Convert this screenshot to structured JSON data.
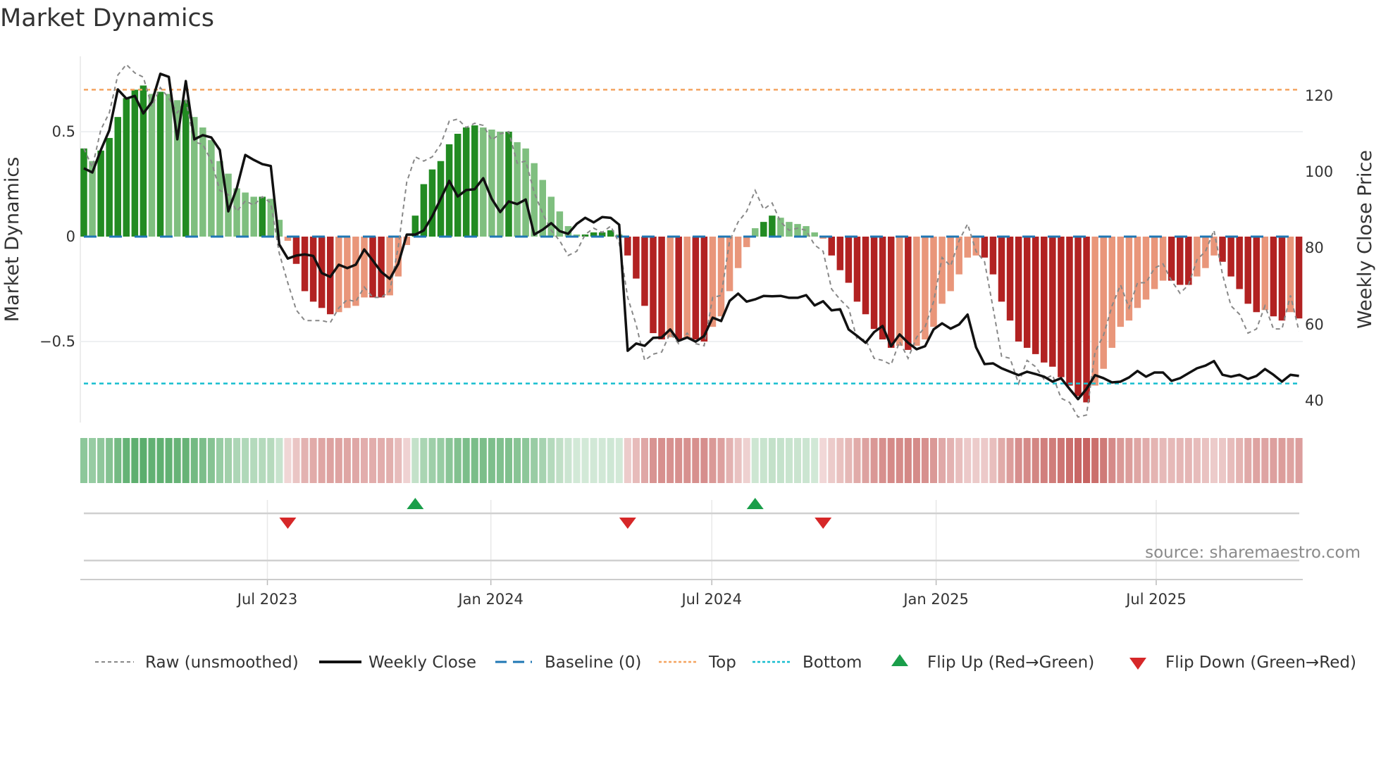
{
  "title": "Market Dynamics",
  "source": "source: sharemaestro.com",
  "chart_data": {
    "type": "bar",
    "title": "Market Dynamics",
    "ylabel": "Market Dynamics",
    "y2label": "Weekly Close Price",
    "ylim": [
      -0.88,
      0.86
    ],
    "y2lim": [
      35,
      130
    ],
    "yticks": [
      {
        "v": 0.5,
        "label": "0.5"
      },
      {
        "v": 0,
        "label": "0"
      },
      {
        "v": -0.5,
        "label": "−0.5"
      }
    ],
    "y2ticks": [
      {
        "v": 120,
        "label": "120"
      },
      {
        "v": 100,
        "label": "100"
      },
      {
        "v": 80,
        "label": "80"
      },
      {
        "v": 60,
        "label": "60"
      },
      {
        "v": 40,
        "label": "40"
      }
    ],
    "xticks": [
      {
        "week": 21.6,
        "label": "Jul 2023"
      },
      {
        "week": 47.9,
        "label": "Jan 2024"
      },
      {
        "week": 73.9,
        "label": "Jul 2024"
      },
      {
        "week": 100.3,
        "label": "Jan 2025"
      },
      {
        "week": 126.2,
        "label": "Jul 2025"
      }
    ],
    "top": 0.7,
    "bottom": -0.7,
    "baseline": 0,
    "colors": {
      "pos_strong": "#228b22",
      "pos_weak": "#7fbf7f",
      "neg_strong": "#b22222",
      "neg_weak": "#e9967a",
      "close": "#111111",
      "raw": "#888888",
      "baseline": "#1f77b4",
      "top": "#f4a460",
      "bottom": "#17becf",
      "flip_up": "#1a9e4a",
      "flip_down": "#d62728",
      "heat_pos": "#3a9d4f",
      "heat_neg": "#c0504d"
    },
    "values": [
      0.42,
      0.36,
      0.41,
      0.47,
      0.57,
      0.66,
      0.7,
      0.72,
      0.68,
      0.69,
      0.68,
      0.65,
      0.65,
      0.57,
      0.52,
      0.46,
      0.36,
      0.3,
      0.23,
      0.21,
      0.19,
      0.19,
      0.18,
      0.08,
      -0.02,
      -0.13,
      -0.26,
      -0.31,
      -0.34,
      -0.37,
      -0.36,
      -0.34,
      -0.33,
      -0.29,
      -0.29,
      -0.29,
      -0.28,
      -0.19,
      -0.04,
      0.1,
      0.25,
      0.32,
      0.36,
      0.44,
      0.49,
      0.52,
      0.53,
      0.52,
      0.51,
      0.5,
      0.5,
      0.45,
      0.42,
      0.35,
      0.27,
      0.19,
      0.12,
      0.05,
      0.01,
      0.01,
      0.02,
      0.02,
      0.03,
      0.01,
      -0.09,
      -0.2,
      -0.33,
      -0.46,
      -0.49,
      -0.48,
      -0.49,
      -0.48,
      -0.49,
      -0.5,
      -0.43,
      -0.38,
      -0.26,
      -0.15,
      -0.05,
      0.04,
      0.07,
      0.1,
      0.09,
      0.07,
      0.06,
      0.05,
      0.02,
      -0.01,
      -0.09,
      -0.16,
      -0.22,
      -0.31,
      -0.37,
      -0.44,
      -0.49,
      -0.53,
      -0.52,
      -0.54,
      -0.52,
      -0.49,
      -0.43,
      -0.32,
      -0.26,
      -0.18,
      -0.1,
      -0.09,
      -0.1,
      -0.18,
      -0.31,
      -0.4,
      -0.5,
      -0.53,
      -0.56,
      -0.6,
      -0.62,
      -0.67,
      -0.71,
      -0.76,
      -0.79,
      -0.71,
      -0.63,
      -0.53,
      -0.43,
      -0.4,
      -0.34,
      -0.3,
      -0.25,
      -0.21,
      -0.21,
      -0.23,
      -0.23,
      -0.19,
      -0.15,
      -0.09,
      -0.12,
      -0.19,
      -0.25,
      -0.32,
      -0.36,
      -0.35,
      -0.38,
      -0.4,
      -0.36,
      -0.39
    ],
    "raw": [
      0.42,
      0.33,
      0.51,
      0.59,
      0.77,
      0.82,
      0.78,
      0.76,
      0.62,
      0.71,
      0.66,
      0.59,
      0.65,
      0.45,
      0.44,
      0.36,
      0.22,
      0.2,
      0.12,
      0.17,
      0.15,
      0.19,
      0.16,
      -0.08,
      -0.22,
      -0.35,
      -0.4,
      -0.4,
      -0.4,
      -0.41,
      -0.34,
      -0.3,
      -0.31,
      -0.24,
      -0.29,
      -0.29,
      -0.26,
      -0.05,
      0.26,
      0.38,
      0.36,
      0.38,
      0.44,
      0.55,
      0.56,
      0.52,
      0.54,
      0.53,
      0.46,
      0.49,
      0.5,
      0.35,
      0.36,
      0.21,
      0.11,
      0.03,
      -0.02,
      -0.09,
      -0.07,
      0.01,
      0.04,
      0.02,
      0.05,
      -0.03,
      -0.29,
      -0.42,
      -0.59,
      -0.56,
      -0.55,
      -0.46,
      -0.51,
      -0.46,
      -0.51,
      -0.52,
      -0.29,
      -0.28,
      -0.02,
      0.07,
      0.12,
      0.22,
      0.13,
      0.16,
      0.07,
      0.03,
      0.04,
      0.03,
      -0.04,
      -0.07,
      -0.25,
      -0.3,
      -0.34,
      -0.49,
      -0.49,
      -0.58,
      -0.59,
      -0.61,
      -0.5,
      -0.58,
      -0.48,
      -0.43,
      -0.31,
      -0.1,
      -0.14,
      -0.02,
      0.06,
      -0.07,
      -0.12,
      -0.34,
      -0.57,
      -0.58,
      -0.7,
      -0.59,
      -0.62,
      -0.68,
      -0.66,
      -0.77,
      -0.79,
      -0.86,
      -0.85,
      -0.55,
      -0.47,
      -0.33,
      -0.23,
      -0.34,
      -0.22,
      -0.22,
      -0.15,
      -0.13,
      -0.21,
      -0.27,
      -0.23,
      -0.11,
      -0.07,
      0.03,
      -0.18,
      -0.33,
      -0.37,
      -0.46,
      -0.44,
      -0.33,
      -0.44,
      -0.44,
      -0.28,
      -0.45
    ],
    "close": [
      101,
      99.9,
      105.8,
      111,
      121.7,
      119.3,
      120,
      115.4,
      118.4,
      125.8,
      125,
      108.6,
      123.9,
      108.6,
      109.7,
      109.1,
      105.8,
      89.7,
      95.8,
      104.5,
      103.2,
      102.1,
      101.6,
      81,
      77.3,
      78.1,
      78.4,
      78,
      73.5,
      72.5,
      75.7,
      74.8,
      75.7,
      79.7,
      76.8,
      73.8,
      72,
      75.9,
      83.6,
      83.6,
      84.7,
      88.4,
      93,
      97.7,
      93.6,
      95.3,
      95.5,
      98.4,
      93,
      89.5,
      92.3,
      91.6,
      92.8,
      83.6,
      84.9,
      86.6,
      84.5,
      83.8,
      86.4,
      88,
      86.8,
      88.2,
      88,
      86.2,
      53.1,
      55,
      54.4,
      56.5,
      56.6,
      58.7,
      55.7,
      56.6,
      55.5,
      57,
      61.8,
      60.9,
      66.2,
      68.1,
      66,
      66.6,
      67.5,
      67.4,
      67.5,
      67,
      67,
      67.7,
      65,
      66.1,
      63.7,
      64,
      58.7,
      57,
      55.2,
      58,
      59.6,
      54.3,
      57.4,
      55.2,
      53.5,
      54.3,
      58.7,
      60.3,
      58.9,
      60,
      62.6,
      54,
      49.6,
      49.8,
      48.5,
      47.6,
      46.7,
      47.6,
      47,
      46.3,
      45,
      45.9,
      43.1,
      40.4,
      43.1,
      46.7,
      45.9,
      44.8,
      45,
      46.1,
      47.8,
      46.3,
      47.4,
      47.4,
      45.2,
      45.9,
      47.2,
      48.5,
      49.2,
      50.4,
      46.8,
      46.3,
      46.8,
      45.7,
      46.5,
      48.3,
      46.8,
      45,
      46.8,
      46.5
    ],
    "flips_up": [
      39,
      79
    ],
    "flips_down": [
      24,
      64,
      87
    ],
    "legend": {
      "placement": "bottom",
      "items": [
        {
          "key": "raw",
          "label": "Raw (unsmoothed)"
        },
        {
          "key": "close",
          "label": "Weekly Close"
        },
        {
          "key": "baseline",
          "label": "Baseline (0)"
        },
        {
          "key": "top",
          "label": "Top"
        },
        {
          "key": "bottom",
          "label": "Bottom"
        },
        {
          "key": "flip_up",
          "label": "Flip Up (Red→Green)"
        },
        {
          "key": "flip_down",
          "label": "Flip Down (Green→Red)"
        }
      ]
    }
  }
}
